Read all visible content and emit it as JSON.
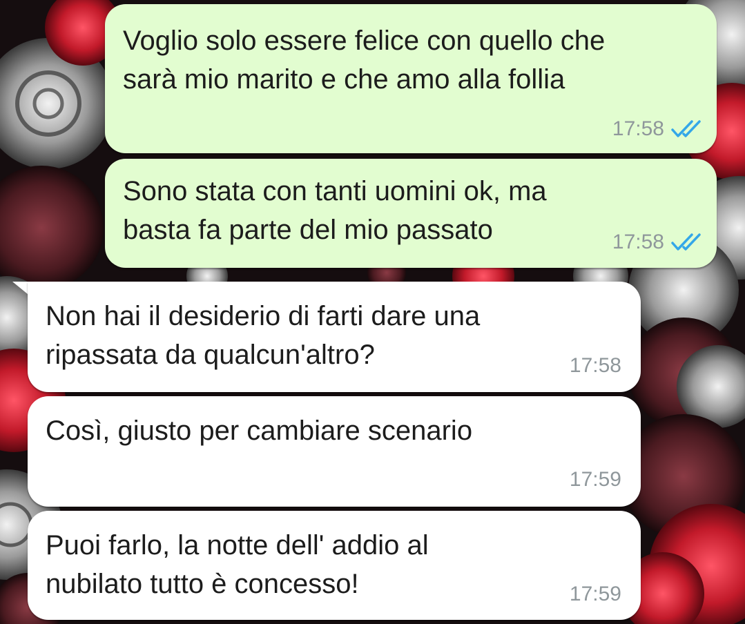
{
  "conversation": {
    "messages": [
      {
        "direction": "outgoing",
        "lines": [
          "Voglio solo essere felice con quello che",
          "sarà mio marito e che amo alla follia"
        ],
        "time": "17:58",
        "status_icon": "double-check-read-icon"
      },
      {
        "direction": "outgoing",
        "lines": [
          "Sono stata con tanti uomini ok, ma",
          "basta fa parte del mio passato"
        ],
        "time": "17:58",
        "status_icon": "double-check-read-icon"
      },
      {
        "direction": "incoming",
        "lines": [
          "Non hai il desiderio di farti dare una",
          "ripassata da qualcun'altro?"
        ],
        "time": "17:58"
      },
      {
        "direction": "incoming",
        "lines": [
          "Così, giusto per cambiare scenario"
        ],
        "time": "17:59"
      },
      {
        "direction": "incoming",
        "lines": [
          "Puoi farlo, la notte dell' addio al",
          "nubilato tutto è concesso!"
        ],
        "time": "17:59"
      }
    ]
  },
  "colors": {
    "outgoing_bubble": "#e2fdd0",
    "incoming_bubble": "#ffffff",
    "read_tick": "#34a7e8",
    "timestamp": "#8f979b",
    "message_text": "#1c1c1c"
  },
  "wallpaper": {
    "theme": "roses",
    "palette": [
      "#150d0f",
      "#c21a2a",
      "#9a9a9a"
    ]
  }
}
